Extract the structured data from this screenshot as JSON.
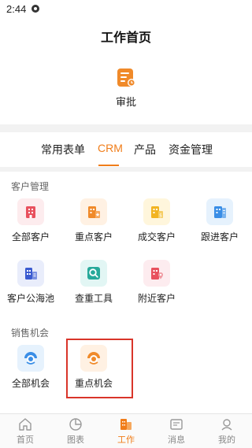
{
  "status": {
    "time": "2:44"
  },
  "header": {
    "title": "工作首页"
  },
  "approval": {
    "label": "审批",
    "icon": "approval-doc-icon"
  },
  "tabs": [
    {
      "label": "常用表单",
      "active": false
    },
    {
      "label": "CRM",
      "active": true
    },
    {
      "label": "产品",
      "active": false
    },
    {
      "label": "资金管理",
      "active": false
    }
  ],
  "sections": {
    "customer": {
      "title": "客户管理",
      "items": [
        {
          "label": "全部客户",
          "icon": "building-icon"
        },
        {
          "label": "重点客户",
          "icon": "building-star-icon"
        },
        {
          "label": "成交客户",
          "icon": "building-money-icon"
        },
        {
          "label": "跟进客户",
          "icon": "building-note-icon"
        },
        {
          "label": "客户公海池",
          "icon": "building-pool-icon"
        },
        {
          "label": "查重工具",
          "icon": "search-icon"
        },
        {
          "label": "附近客户",
          "icon": "building-location-icon"
        }
      ]
    },
    "opportunity": {
      "title": "销售机会",
      "items": [
        {
          "label": "全部机会",
          "icon": "opportunity-icon"
        },
        {
          "label": "重点机会",
          "icon": "key-opportunity-icon"
        }
      ]
    }
  },
  "bottom_nav": [
    {
      "label": "首页",
      "icon": "home-icon",
      "active": false
    },
    {
      "label": "图表",
      "icon": "chart-icon",
      "active": false
    },
    {
      "label": "工作",
      "icon": "work-icon",
      "active": true
    },
    {
      "label": "消息",
      "icon": "message-icon",
      "active": false
    },
    {
      "label": "我的",
      "icon": "profile-icon",
      "active": false
    }
  ],
  "colors": {
    "accent": "#f07d1a",
    "highlight_border": "#d9352a",
    "icon_red": "#e8515e",
    "icon_orange": "#f08a2a",
    "icon_yellow": "#f2b422",
    "icon_blue": "#3a8ee6",
    "icon_navy": "#3b5bd0",
    "icon_teal": "#27a99a"
  }
}
